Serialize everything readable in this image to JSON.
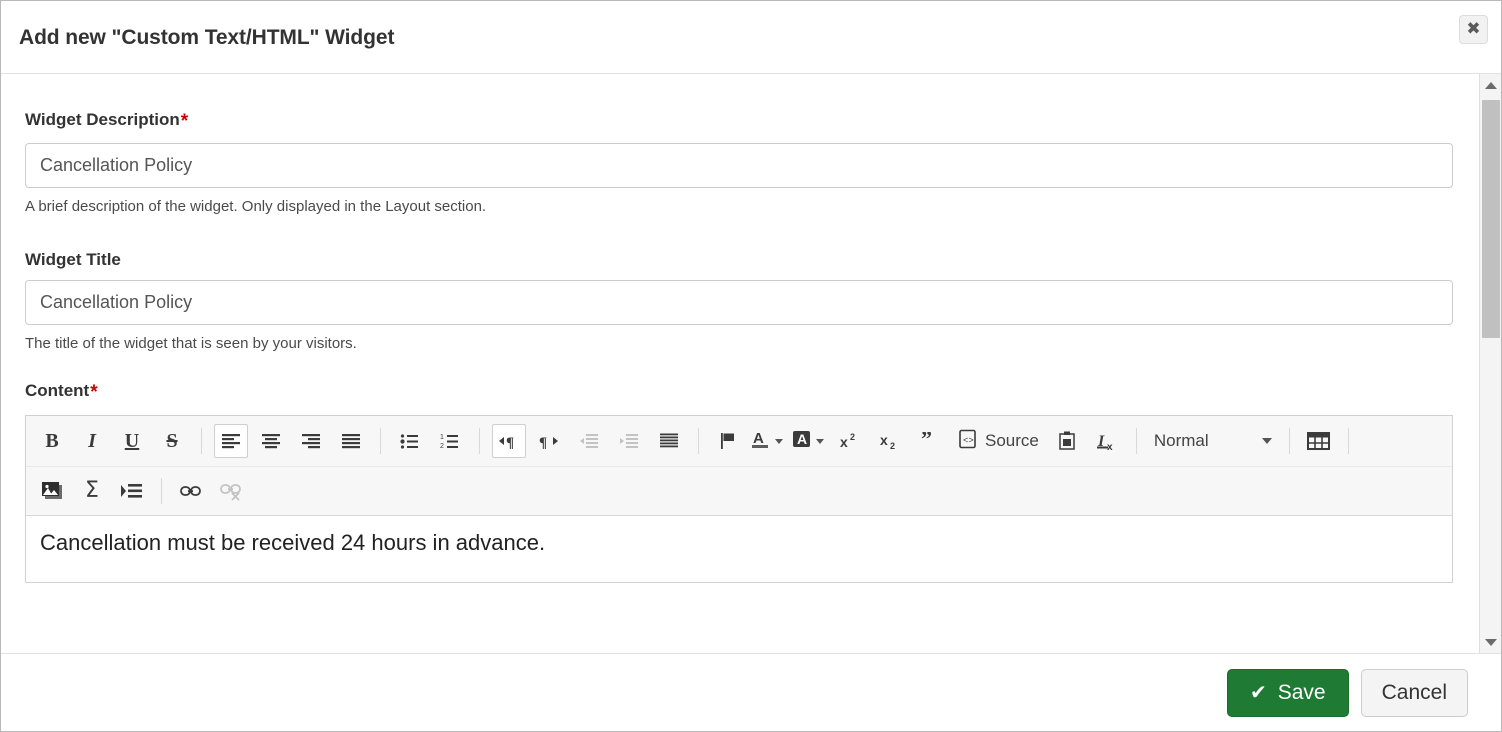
{
  "dialog": {
    "title": "Add new \"Custom Text/HTML\" Widget",
    "close_icon": "close-icon"
  },
  "fields": {
    "description": {
      "label": "Widget Description",
      "required_mark": "*",
      "value": "Cancellation Policy",
      "placeholder": "Cancellation Policy",
      "help": "A brief description of the widget. Only displayed in the Layout section."
    },
    "title": {
      "label": "Widget Title",
      "value": "Cancellation Policy",
      "placeholder": "Cancellation Policy",
      "help": "The title of the widget that is seen by your visitors."
    },
    "content": {
      "label": "Content",
      "required_mark": "*",
      "body_text": "Cancellation must be received 24 hours in advance."
    }
  },
  "editor_toolbar": {
    "row1": [
      {
        "name": "bold-icon",
        "glyph": "B",
        "style": "bold",
        "state": "normal"
      },
      {
        "name": "italic-icon",
        "glyph": "I",
        "style": "italic",
        "state": "normal"
      },
      {
        "name": "underline-icon",
        "glyph": "U",
        "style": "underline",
        "state": "normal"
      },
      {
        "name": "strikethrough-icon",
        "glyph": "S",
        "style": "strike",
        "state": "normal"
      },
      {
        "name": "separator",
        "glyph": "",
        "style": "sep",
        "state": "normal"
      },
      {
        "name": "align-left-icon",
        "glyph": "",
        "style": "align-left",
        "state": "active"
      },
      {
        "name": "align-center-icon",
        "glyph": "",
        "style": "align-center",
        "state": "normal"
      },
      {
        "name": "align-right-icon",
        "glyph": "",
        "style": "align-right",
        "state": "normal"
      },
      {
        "name": "align-justify-icon",
        "glyph": "",
        "style": "align-justify",
        "state": "normal"
      },
      {
        "name": "separator",
        "glyph": "",
        "style": "sep",
        "state": "normal"
      },
      {
        "name": "bulleted-list-icon",
        "glyph": "",
        "style": "ul",
        "state": "normal"
      },
      {
        "name": "numbered-list-icon",
        "glyph": "",
        "style": "ol",
        "state": "normal"
      },
      {
        "name": "text-direction-ltr-icon",
        "glyph": "",
        "style": "ltr",
        "state": "active"
      },
      {
        "name": "text-direction-rtl-icon",
        "glyph": "",
        "style": "rtl",
        "state": "normal"
      },
      {
        "name": "decrease-indent-icon",
        "glyph": "",
        "style": "outdent",
        "state": "disabled"
      },
      {
        "name": "increase-indent-icon",
        "glyph": "",
        "style": "indent",
        "state": "normal"
      },
      {
        "name": "block-justify-icon",
        "glyph": "",
        "style": "blockjustify",
        "state": "normal"
      },
      {
        "name": "separator",
        "glyph": "",
        "style": "sep",
        "state": "normal"
      },
      {
        "name": "anchor-flag-icon",
        "glyph": "",
        "style": "flag",
        "state": "normal"
      }
    ],
    "text_color": {
      "name": "text-color-icon",
      "label": "A"
    },
    "background_color": {
      "name": "background-color-icon",
      "label": "A"
    },
    "row1_tail": [
      {
        "name": "superscript-icon",
        "glyph": "x",
        "sup": "2",
        "style": "sup",
        "state": "normal"
      },
      {
        "name": "subscript-icon",
        "glyph": "x",
        "sub": "2",
        "style": "sub",
        "state": "normal"
      },
      {
        "name": "blockquote-icon",
        "glyph": "”",
        "style": "quote",
        "state": "normal"
      }
    ],
    "source_button": {
      "name": "source-button",
      "label": "Source"
    },
    "paste_from_word": {
      "name": "paste-from-word-icon"
    },
    "remove_format": {
      "name": "remove-format-icon",
      "glyph": "I",
      "sub": "x"
    },
    "paragraph_format": {
      "name": "paragraph-format-dropdown",
      "value": "Normal"
    },
    "table": {
      "name": "insert-table-icon"
    },
    "row2": [
      {
        "name": "insert-image-icon",
        "state": "normal"
      },
      {
        "name": "insert-formula-icon",
        "glyph": "Σ",
        "state": "normal"
      },
      {
        "name": "insert-page-break-icon",
        "state": "normal"
      },
      {
        "name": "separator",
        "style": "sep",
        "state": "normal"
      },
      {
        "name": "insert-link-icon",
        "state": "normal"
      },
      {
        "name": "unlink-icon",
        "state": "disabled"
      }
    ]
  },
  "scrollbar": {
    "up_arrow": "scroll-up-arrow",
    "down_arrow": "scroll-down-arrow",
    "thumb": "scroll-thumb"
  },
  "footer": {
    "save_label": "Save",
    "save_icon": "check-icon",
    "cancel_label": "Cancel"
  },
  "colors": {
    "save_green": "#1f7a34",
    "required_red": "#cc0000",
    "toolbar_bg": "#f7f7f7",
    "border": "#cccccc"
  }
}
